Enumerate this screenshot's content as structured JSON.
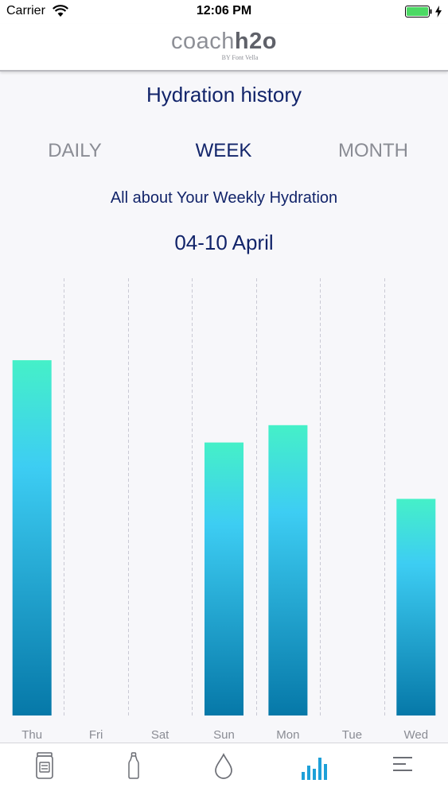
{
  "status_bar": {
    "carrier": "Carrier",
    "time": "12:06 PM"
  },
  "header": {
    "logo_light": "coach",
    "logo_bold": "h2o",
    "logo_sub": "BY Font Vella"
  },
  "page": {
    "title": "Hydration history",
    "subtitle": "All about Your Weekly Hydration",
    "date_range": "04-10 April"
  },
  "tabs": [
    {
      "label": "DAILY",
      "active": false
    },
    {
      "label": "WEEK",
      "active": true
    },
    {
      "label": "MONTH",
      "active": false
    }
  ],
  "chart_data": {
    "type": "bar",
    "categories": [
      "Thu",
      "Fri",
      "Sat",
      "Sun",
      "Mon",
      "Tue",
      "Wed"
    ],
    "values": [
      82,
      0,
      0,
      63,
      67,
      0,
      50
    ],
    "ylim": [
      0,
      100
    ],
    "grid": true,
    "colors": {
      "top": "#45f0c8",
      "middle": "#3dcdf3",
      "bottom": "#0678a8",
      "grid": "#c9c9d4"
    }
  },
  "tab_bar": {
    "items": [
      {
        "icon": "water-jug-icon",
        "active": false
      },
      {
        "icon": "bottle-icon",
        "active": false
      },
      {
        "icon": "water-drop-icon",
        "active": false
      },
      {
        "icon": "bar-chart-icon",
        "active": true
      },
      {
        "icon": "menu-icon",
        "active": false
      }
    ],
    "active_color": "#1ea0d8",
    "inactive_color": "#6c6e75"
  }
}
